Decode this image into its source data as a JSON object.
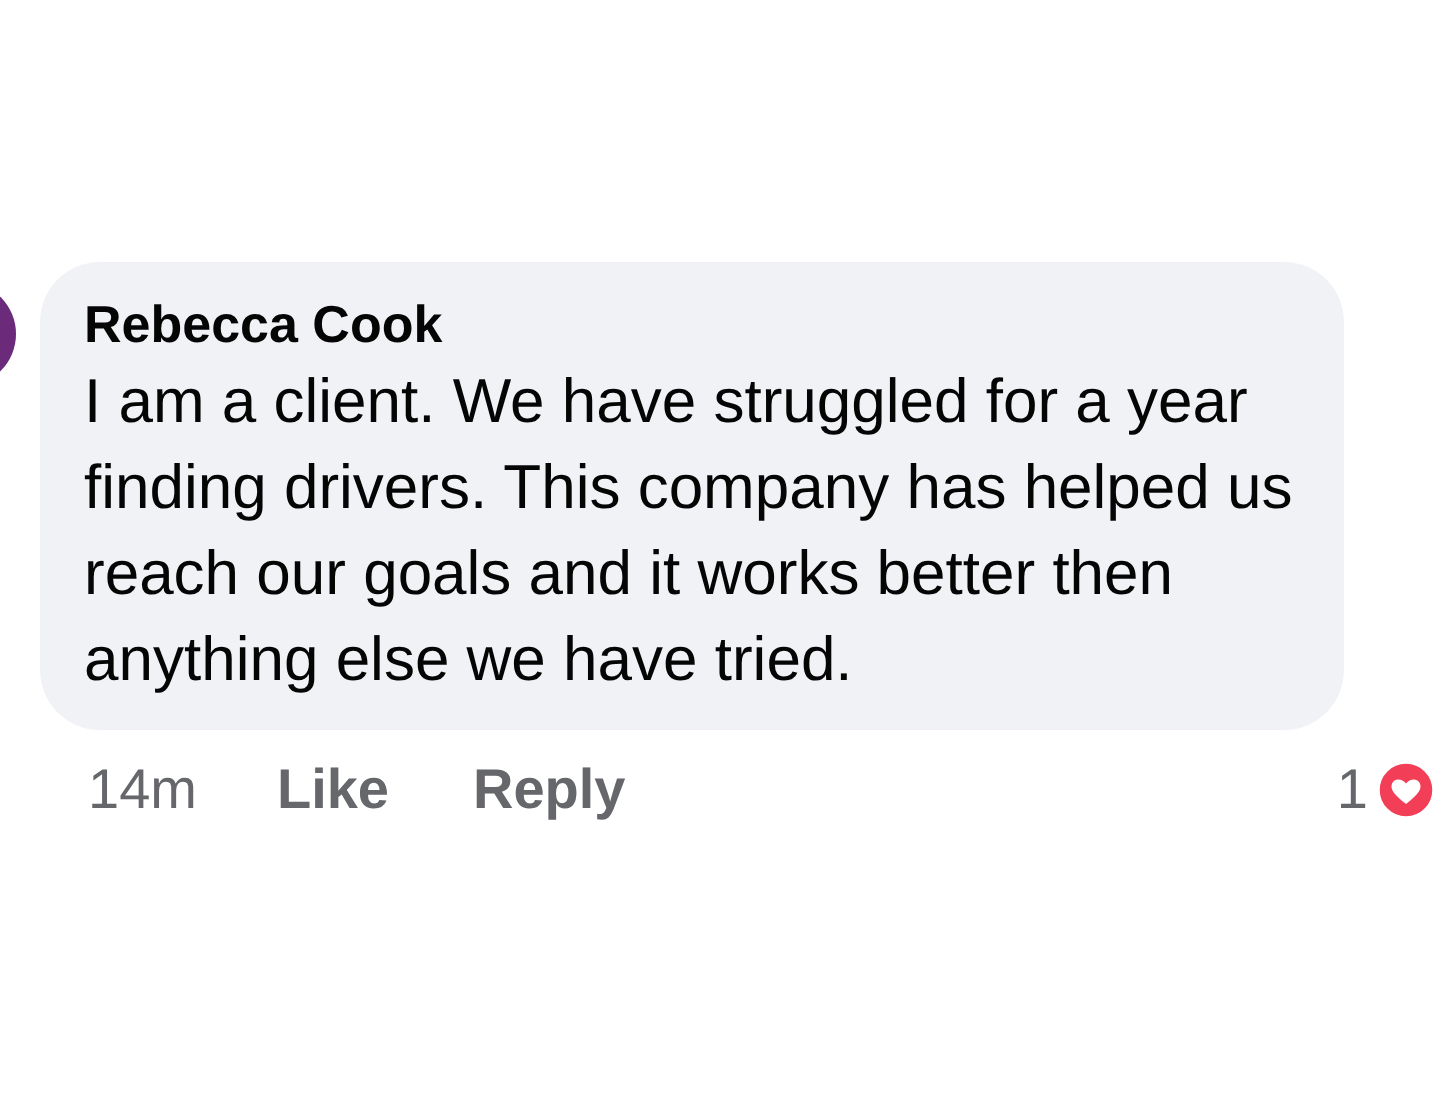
{
  "comment": {
    "author": "Rebecca Cook",
    "text": "I am a client. We have struggled for a year finding drivers. This company has helped us reach our goals and it works better then anything else we have tried."
  },
  "actions": [
    {
      "label": "14m",
      "kind": "time"
    },
    {
      "label": "Like",
      "kind": "link"
    },
    {
      "label": "Reply",
      "kind": "link"
    }
  ],
  "reactions": {
    "count": "1"
  }
}
